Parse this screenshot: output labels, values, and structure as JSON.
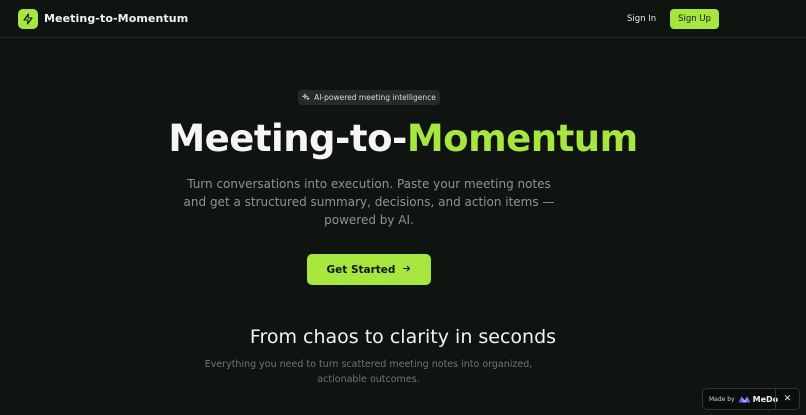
{
  "nav": {
    "brand_name": "Meeting-to-Momentum",
    "brand_icon": "lightning-icon",
    "sign_in": "Sign In",
    "sign_up": "Sign Up"
  },
  "hero": {
    "badge_icon": "sparkles-icon",
    "badge": "AI-powered meeting intelligence",
    "title_prefix": "Meeting-to-",
    "title_accent": "Momentum",
    "subtitle": "Turn conversations into execution. Paste your meeting notes and get a structured summary, decisions, and action items — powered by AI.",
    "cta": "Get Started",
    "cta_icon": "arrow-right-icon"
  },
  "section": {
    "title": "From chaos to clarity in seconds",
    "subtitle": "Everything you need to turn scattered meeting notes into organized, actionable outcomes."
  },
  "made_by": {
    "label": "Made by",
    "brand": "MeDo",
    "close_icon": "close-icon"
  },
  "colors": {
    "background": "#0f1411",
    "accent": "#a6e63f",
    "text": "#f3f4f1",
    "muted": "#8d948e"
  }
}
